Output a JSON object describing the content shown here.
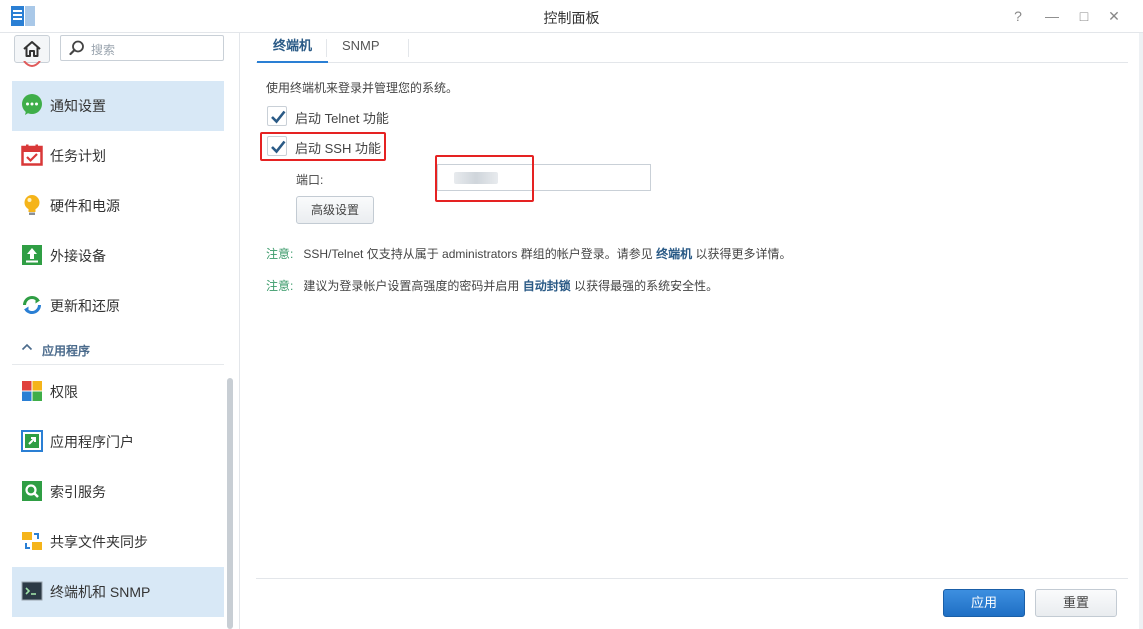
{
  "window": {
    "title": "控制面板",
    "controls": {
      "help": "?",
      "minimize": "—",
      "maximize": "□",
      "close": "✕"
    }
  },
  "sidebar": {
    "search_placeholder": "搜索",
    "items": [
      {
        "label": "通知设置",
        "icon": "notification-icon",
        "active": false
      },
      {
        "label": "任务计划",
        "icon": "calendar-icon",
        "active": false
      },
      {
        "label": "硬件和电源",
        "icon": "lightbulb-icon",
        "active": false
      },
      {
        "label": "外接设备",
        "icon": "external-device-icon",
        "active": false
      },
      {
        "label": "更新和还原",
        "icon": "update-restore-icon",
        "active": false
      }
    ],
    "section_apps": {
      "label": "应用程序"
    },
    "app_items": [
      {
        "label": "权限",
        "icon": "privileges-icon"
      },
      {
        "label": "应用程序门户",
        "icon": "application-portal-icon"
      },
      {
        "label": "索引服务",
        "icon": "indexing-service-icon"
      },
      {
        "label": "共享文件夹同步",
        "icon": "shared-folder-sync-icon"
      },
      {
        "label": "终端机和 SNMP",
        "icon": "terminal-icon",
        "active": true
      }
    ]
  },
  "tabs": [
    {
      "label": "终端机",
      "active": true
    },
    {
      "label": "SNMP",
      "active": false
    }
  ],
  "content": {
    "description": "使用终端机来登录并管理您的系统。",
    "telnet": {
      "label": "启动 Telnet 功能",
      "checked": true
    },
    "ssh": {
      "label": "启动 SSH 功能",
      "checked": true
    },
    "port_label": "端口:",
    "port_value": "",
    "advanced_button": "高级设置",
    "note1": {
      "tag": "注意:",
      "text": "SSH/Telnet 仅支持从属于 administrators 群组的帐户登录。请参见",
      "link": "终端机",
      "suffix": "以获得更多详情。"
    },
    "note2": {
      "tag": "注意:",
      "text": "建议为登录帐户设置高强度的密码并启用",
      "link": "自动封锁",
      "suffix": "以获得最强的系统安全性。"
    }
  },
  "footer": {
    "apply": "应用",
    "reset": "重置"
  },
  "colors": {
    "accent": "#2a7fd4",
    "active_row": "#d8e8f6",
    "note_green": "#3a9a6a",
    "highlight_red": "#e52222"
  }
}
